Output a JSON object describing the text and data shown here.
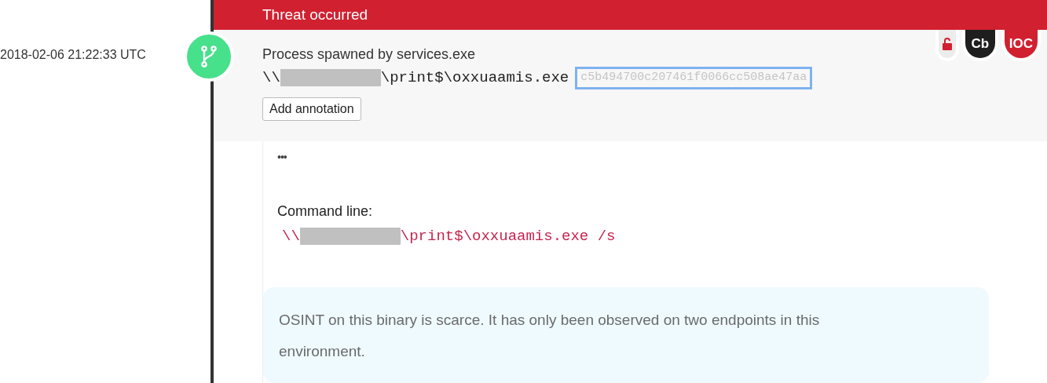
{
  "timestamp": "2018-02-06 21:22:33 UTC",
  "header": {
    "title": "Threat occurred"
  },
  "event": {
    "description": "Process spawned by services.exe",
    "path_prefix": "\\\\",
    "path_suffix": "\\print$\\oxxuaamis.exe",
    "hash": "c5b494700c207461f0066cc508ae47aa",
    "button": "Add annotation"
  },
  "badges": [
    {
      "kind": "lock"
    },
    {
      "kind": "text",
      "label": "Cb",
      "color": "#1e1e1e"
    },
    {
      "kind": "text",
      "label": "IOC",
      "color": "#d12030"
    }
  ],
  "details": {
    "more": "•••",
    "command_label": "Command line:",
    "command_prefix": "\\\\",
    "command_suffix": "\\print$\\oxxuaamis.exe /s"
  },
  "note": "OSINT on this binary is scarce. It has only been observed on two endpoints in this environment."
}
